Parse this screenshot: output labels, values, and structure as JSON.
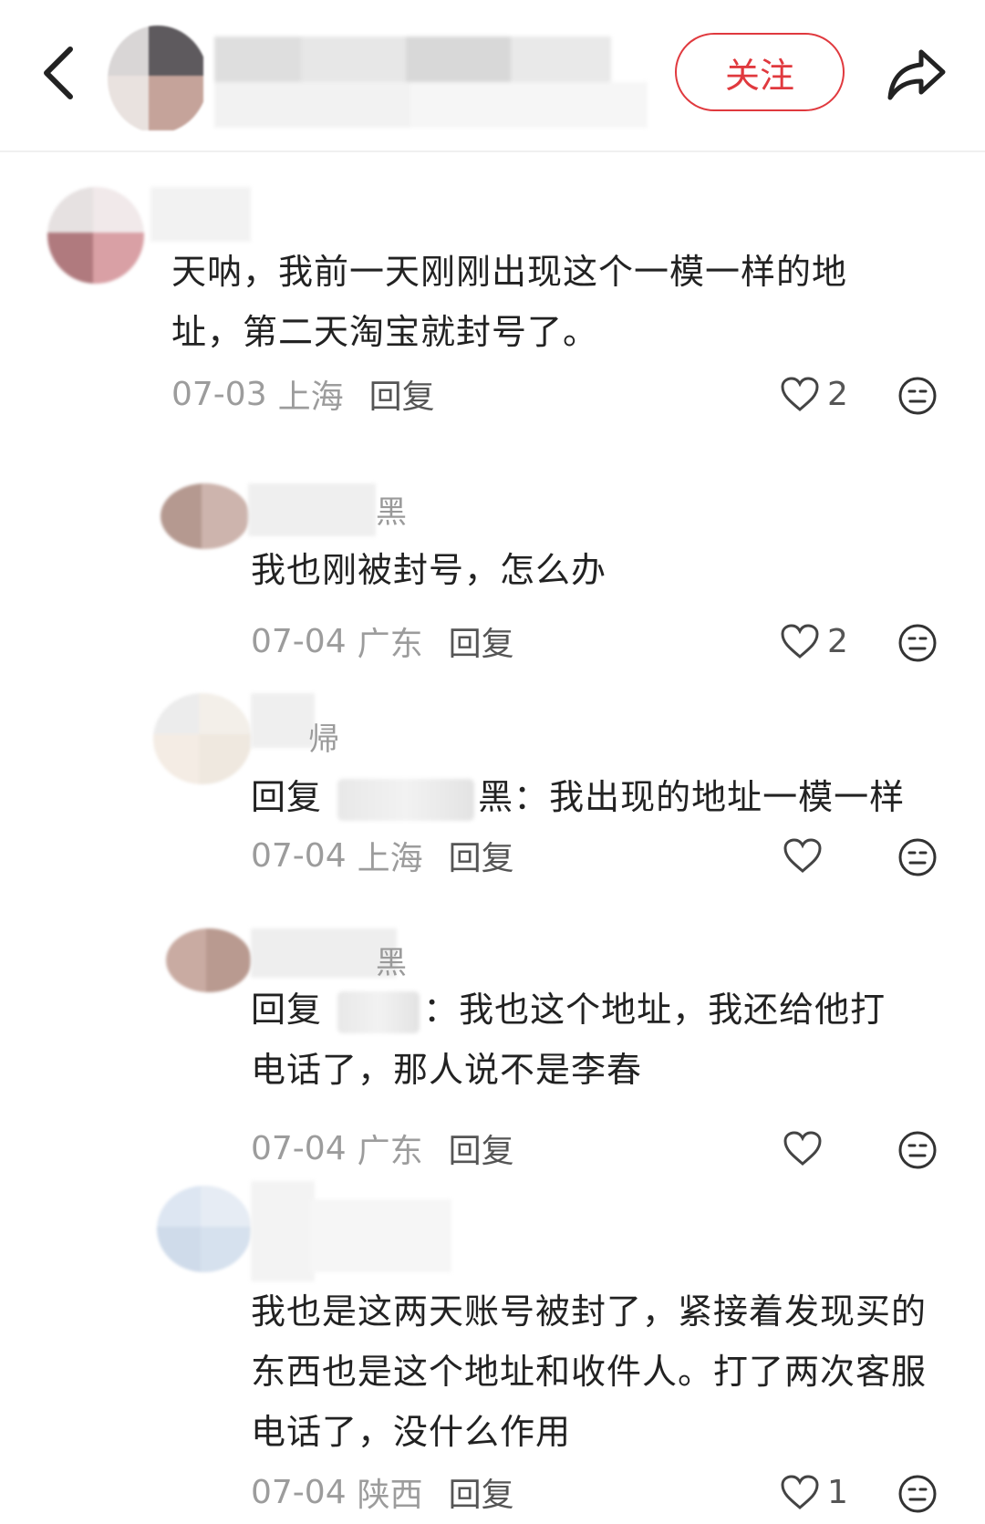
{
  "header": {
    "follow_label": "关注"
  },
  "comments": [
    {
      "text": "天呐，我前一天刚刚出现这个一模一样的地址，第二天淘宝就封号了。",
      "date": "07-03",
      "location": "上海",
      "reply_label": "回复",
      "likes": "2"
    },
    {
      "name_tail": "黑",
      "text": "我也刚被封号，怎么办",
      "date": "07-04",
      "location": "广东",
      "reply_label": "回复",
      "likes": "2"
    },
    {
      "name_tail": "帰",
      "reply_prefix": "回复",
      "mention_tail": "黑：",
      "text": "我出现的地址一模一样",
      "date": "07-04",
      "location": "上海",
      "reply_label": "回复",
      "likes": ""
    },
    {
      "name_tail": "黑",
      "reply_prefix": "回复",
      "mention_tail": "：",
      "text_line1": "我也这个地址，我还给他打",
      "text_line2": "电话了，那人说不是李春",
      "date": "07-04",
      "location": "广东",
      "reply_label": "回复",
      "likes": ""
    },
    {
      "text": "我也是这两天账号被封了，紧接着发现买的东西也是这个地址和收件人。打了两次客服电话了，没什么作用",
      "date": "07-04",
      "location": "陕西",
      "reply_label": "回复",
      "likes": "1"
    }
  ],
  "colors": {
    "accent": "#e0393e",
    "meta_text": "#9c9c9c",
    "body_text": "#222222"
  },
  "icons": [
    "back-chevron-icon",
    "share-arrow-icon",
    "heart-icon",
    "emoji-face-icon"
  ]
}
